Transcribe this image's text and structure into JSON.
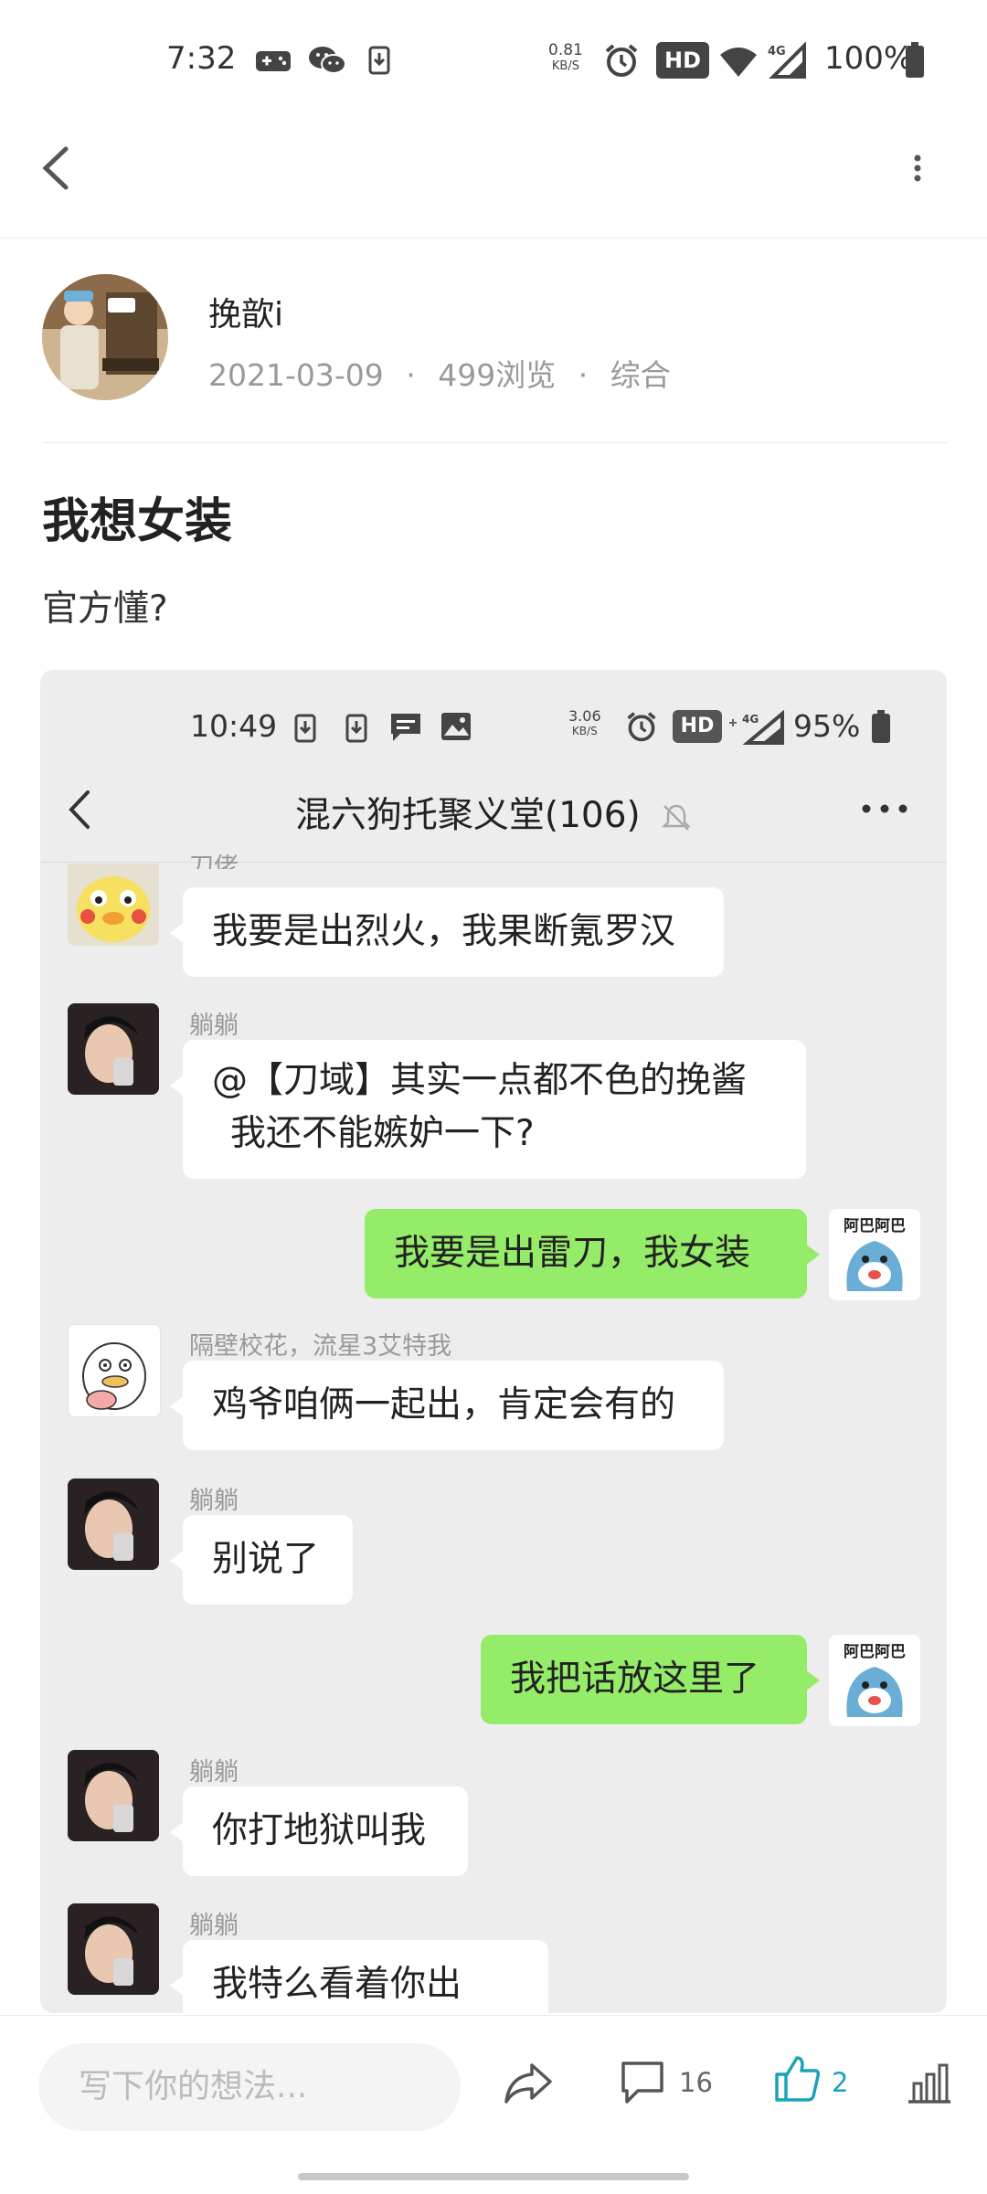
{
  "status_bar": {
    "time": "7:32",
    "net_speed_value": "0.81",
    "net_speed_unit": "KB/S",
    "hd": "HD",
    "signal": "4G",
    "battery": "100%"
  },
  "post": {
    "author": "挽歆i",
    "date": "2021-03-09",
    "views": "499浏览",
    "category": "综合",
    "title": "我想女装",
    "body": "官方懂?"
  },
  "screenshot": {
    "status": {
      "time": "10:49",
      "net_speed_value": "3.06",
      "net_speed_unit": "KB/S",
      "hd": "HD",
      "signal": "4G",
      "battery": "95%"
    },
    "chat_title": "混六狗托聚义堂(106)",
    "messages": [
      {
        "sender": "刀佬",
        "text": "我要是出烈火，我果断氪罗汉",
        "mine": false
      },
      {
        "sender": "躺躺",
        "line1": "@【刀域】其实一点都不色的挽酱",
        "line2": "我还不能嫉妒一下?",
        "mine": false
      },
      {
        "text": "我要是出雷刀，我女装",
        "mine": true
      },
      {
        "sender": "隔壁校花，流星3艾特我",
        "text": "鸡爷咱俩一起出，肯定会有的",
        "mine": false
      },
      {
        "sender": "躺躺",
        "text": "别说了",
        "mine": false
      },
      {
        "text": "我把话放这里了",
        "mine": true
      },
      {
        "sender": "躺躺",
        "text": "你打地狱叫我",
        "mine": false
      },
      {
        "sender": "躺躺",
        "text": "我特么看着你出",
        "mine": false
      }
    ],
    "sticker_text": "阿巴阿巴"
  },
  "bottom_bar": {
    "input_placeholder": "写下你的想法...",
    "comments": "16",
    "likes": "2"
  },
  "colors": {
    "accent": "#1aa3b8",
    "bubble_mine": "#95ec69",
    "chat_bg": "#ededed"
  }
}
